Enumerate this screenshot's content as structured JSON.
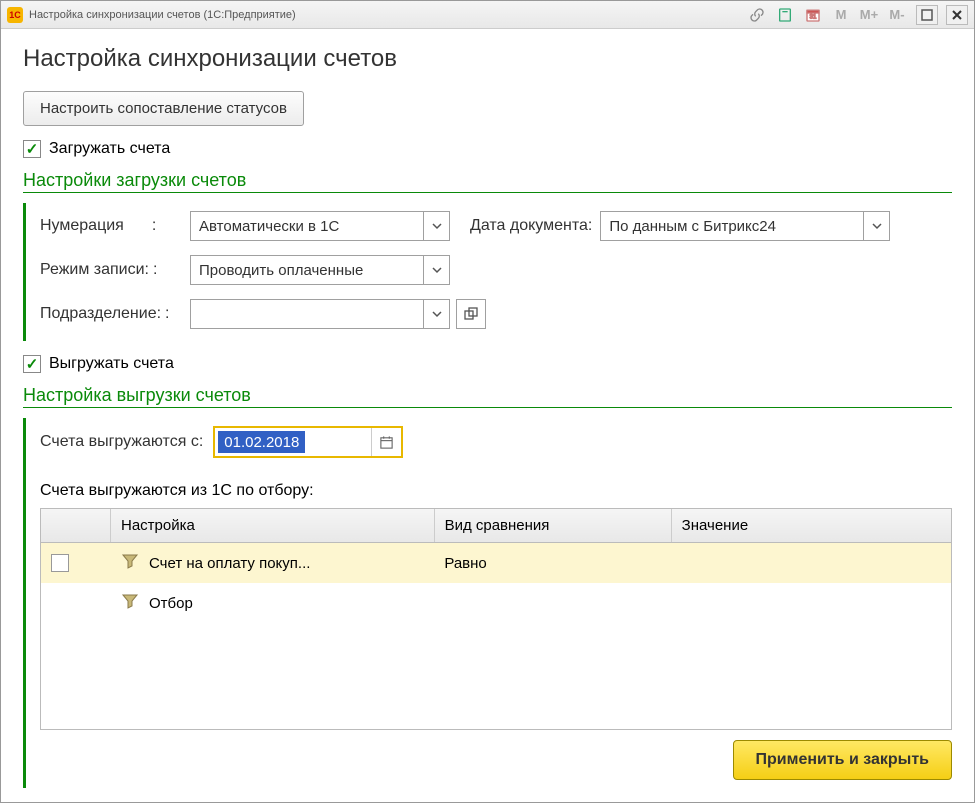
{
  "titlebar": {
    "app_badge": "1C",
    "title": "Настройка синхронизации счетов  (1С:Предприятие)"
  },
  "page_title": "Настройка синхронизации счетов",
  "buttons": {
    "configure_status_mapping": "Настроить сопоставление статусов",
    "apply_and_close": "Применить и закрыть"
  },
  "checkboxes": {
    "load_invoices": "Загружать счета",
    "export_invoices": "Выгружать счета"
  },
  "sections": {
    "load_settings": "Настройки загрузки счетов",
    "export_settings": "Настройка выгрузки счетов"
  },
  "load": {
    "numbering_label": "Нумерация",
    "numbering_value": "Автоматически в 1С",
    "doc_date_label": "Дата документа:",
    "doc_date_value": "По данным с Битрикс24",
    "write_mode_label": "Режим записи:",
    "write_mode_value": "Проводить оплаченные",
    "department_label": "Подразделение:",
    "department_value": ""
  },
  "export": {
    "from_label": "Счета выгружаются с:",
    "from_value": "01.02.2018",
    "filter_label": "Счета выгружаются из 1С по отбору:"
  },
  "table": {
    "headers": {
      "setting": "Настройка",
      "comparison": "Вид сравнения",
      "value": "Значение"
    },
    "rows": [
      {
        "checked": false,
        "setting": "Счет на оплату покуп...",
        "comparison": "Равно",
        "value": ""
      },
      {
        "checked": null,
        "setting": "Отбор",
        "comparison": "",
        "value": ""
      }
    ]
  }
}
